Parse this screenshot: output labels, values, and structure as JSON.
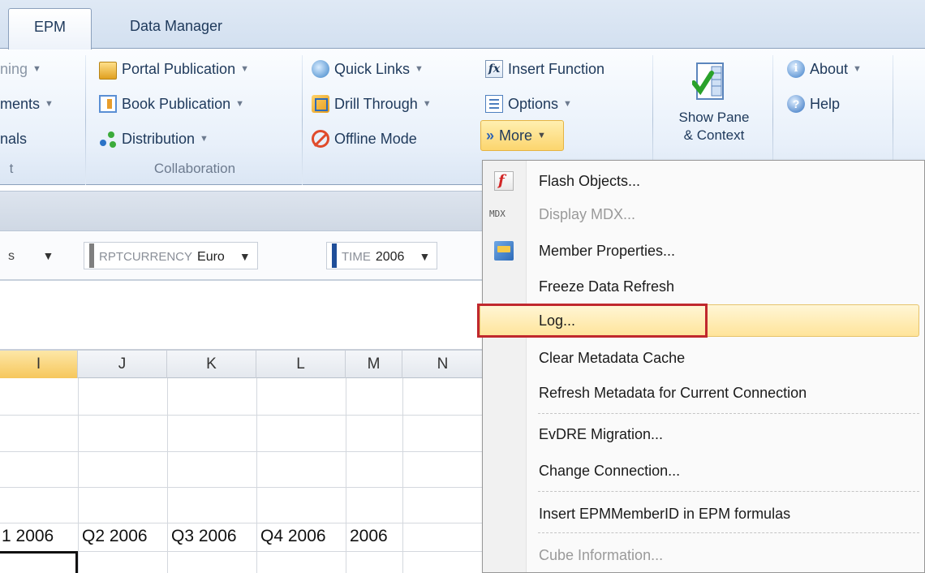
{
  "tabs": [
    {
      "label": "EPM",
      "active": true
    },
    {
      "label": "Data Manager",
      "active": false
    }
  ],
  "ribbon": {
    "partial_group": {
      "items": [
        "ning",
        "ments",
        "nals"
      ],
      "group_label": "t"
    },
    "collaboration": {
      "group_label": "Collaboration",
      "portal_publication": "Portal Publication",
      "book_publication": "Book Publication",
      "distribution": "Distribution"
    },
    "tools": {
      "quick_links": "Quick Links",
      "drill_through": "Drill Through",
      "offline_mode": "Offline Mode",
      "insert_function": "Insert Function",
      "options": "Options",
      "more": "More"
    },
    "show_pane": {
      "line1": "Show Pane",
      "line2": "& Context"
    },
    "help_group": {
      "about": "About",
      "help": "Help"
    },
    "icon_glyphs": {
      "fx": "fx",
      "about": "i",
      "help": "?",
      "more_chevron": "»",
      "dropdown": "▼"
    }
  },
  "dimension_bar": {
    "partial_value": "s",
    "rptcurrency": {
      "name": "RPTCURRENCY",
      "value": "Euro",
      "tag_color": "#7f7f7f"
    },
    "time": {
      "name": "TIME",
      "value": "2006",
      "tag_color": "#1f4e99"
    }
  },
  "grid": {
    "columns": [
      "I",
      "J",
      "K",
      "L",
      "M",
      "N"
    ],
    "selected_column": "I",
    "row_values": [
      "1 2006",
      "Q2 2006",
      "Q3 2006",
      "Q4 2006",
      "2006"
    ]
  },
  "more_menu": {
    "items": [
      {
        "label": "Flash Objects...",
        "icon": "flash-objects-icon",
        "disabled": false
      },
      {
        "label": "Display MDX...",
        "icon": "mdx-icon",
        "icon_text": "MDX",
        "disabled": true
      },
      {
        "label": "Member Properties...",
        "icon": "member-properties-icon",
        "disabled": false
      },
      {
        "label": "Freeze Data Refresh",
        "disabled": false
      },
      {
        "label": "Log...",
        "disabled": false,
        "highlighted": true
      },
      {
        "label": "Clear Metadata Cache",
        "disabled": false
      },
      {
        "label": "Refresh Metadata for Current Connection",
        "disabled": false
      },
      {
        "label": "EvDRE Migration...",
        "disabled": false
      },
      {
        "label": "Change Connection...",
        "disabled": false
      },
      {
        "label": "Insert EPMMemberID in EPM formulas",
        "disabled": false
      },
      {
        "label": "Cube Information...",
        "disabled": true
      }
    ]
  },
  "colors": {
    "highlight_box": "#c0282d",
    "menu_hover": "#ffe49a",
    "accent": "#2c62b5"
  }
}
